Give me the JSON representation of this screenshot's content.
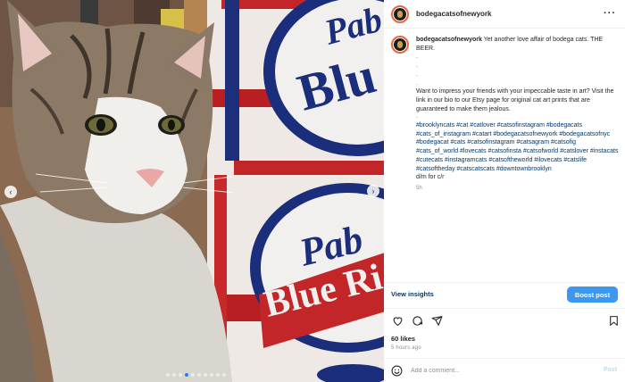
{
  "post": {
    "username": "bodegacatsofnewyork",
    "more_icon": "more-horizontal-icon",
    "caption": {
      "username": "bodegacatsofnewyork",
      "lead": " Yet another love affair of bodega cats. THE BEER.",
      "dots": [
        ".",
        ".",
        ".",
        "."
      ],
      "body": "Want to impress your friends with your impeccable taste in art? Visit the link in our bio to our Etsy page for original cat art prints that are guaranteed to make them jealous.",
      "dot_after": ".",
      "hashtags": "#brooklyncats #cat #catlover #catsofinstagram #bodegacats #cats_of_instagram #catart #bodegacatsofnewyork #bodegacatsofnyc #bodegacat #cats #catsofinstagram #catsagram #catsofig #cats_of_world #lovecats #catsofinsta #catsofworld #catslover #instacats #cutecats #instagramcats #catsoftheworld #ilovecats #catslife #catsoftheday #catscatscats #downtownbrooklyn",
      "credit": "d/m for c/r",
      "time": "5h"
    },
    "view_insights": "View insights",
    "boost_label": "Boost post",
    "likes": "60 likes",
    "posted_ago": "5 hours ago",
    "comment": {
      "placeholder": "Add a comment...",
      "value": "",
      "post_label": "Post"
    },
    "carousel": {
      "count": 10,
      "active_index": 3
    },
    "colors": {
      "accent": "#3b97f0",
      "link": "#00376b",
      "muted": "#8e8e8e"
    }
  }
}
